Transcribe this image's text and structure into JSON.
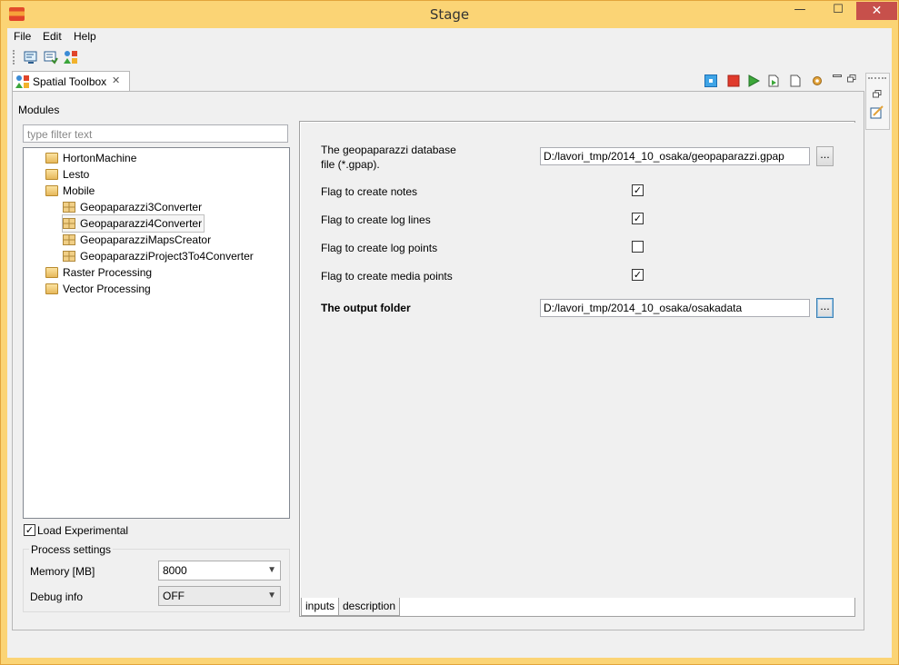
{
  "window": {
    "title": "Stage",
    "minimize": "—",
    "maximize": "☐",
    "close": "✕"
  },
  "menu": [
    "File",
    "Edit",
    "Help"
  ],
  "toolbar": {
    "icons": [
      "console-icon",
      "preferences-icon",
      "spatial-toolbox-icon"
    ]
  },
  "view": {
    "tab_label": "Spatial Toolbox",
    "close_glyph": "✕",
    "toolbar_icons": [
      "stop-icon",
      "kill-icon",
      "run-icon",
      "generate-script-icon",
      "new-script-icon",
      "settings-icon",
      "minimize-view-icon",
      "maximize-view-icon"
    ]
  },
  "left": {
    "modules_label": "Modules",
    "filter_placeholder": "type filter text",
    "tree": [
      {
        "label": "HortonMachine",
        "level": 1,
        "type": "folder"
      },
      {
        "label": "Lesto",
        "level": 1,
        "type": "folder"
      },
      {
        "label": "Mobile",
        "level": 1,
        "type": "folder"
      },
      {
        "label": "Geopaparazzi3Converter",
        "level": 2,
        "type": "module"
      },
      {
        "label": "Geopaparazzi4Converter",
        "level": 2,
        "type": "module",
        "selected": true
      },
      {
        "label": "GeopaparazziMapsCreator",
        "level": 2,
        "type": "module"
      },
      {
        "label": "GeopaparazziProject3To4Converter",
        "level": 2,
        "type": "module"
      },
      {
        "label": "Raster Processing",
        "level": 1,
        "type": "folder"
      },
      {
        "label": "Vector Processing",
        "level": 1,
        "type": "folder"
      }
    ],
    "load_experimental": {
      "label": "Load Experimental",
      "checked": true
    },
    "process_settings": {
      "title": "Process settings",
      "memory_label": "Memory [MB]",
      "memory_value": "8000",
      "debug_label": "Debug info",
      "debug_value": "OFF"
    }
  },
  "right": {
    "db_label_line1": "The geopaparazzi database",
    "db_label_line2": "file (*.gpap).",
    "db_value": "D:/lavori_tmp/2014_10_osaka/geopaparazzi.gpap",
    "browse": "...",
    "flags": [
      {
        "label": "Flag to create notes",
        "checked": true
      },
      {
        "label": "Flag to create log lines",
        "checked": true
      },
      {
        "label": "Flag to create log points",
        "checked": false
      },
      {
        "label": "Flag to create media points",
        "checked": true
      }
    ],
    "output_label": "The output folder",
    "output_value": "D:/lavori_tmp/2014_10_osaka/osakadata",
    "tabs": [
      "inputs",
      "description"
    ]
  },
  "colors": {
    "titlebar": "#fbd475",
    "close": "#c7504b",
    "view_accent": "#4e9bd8"
  }
}
